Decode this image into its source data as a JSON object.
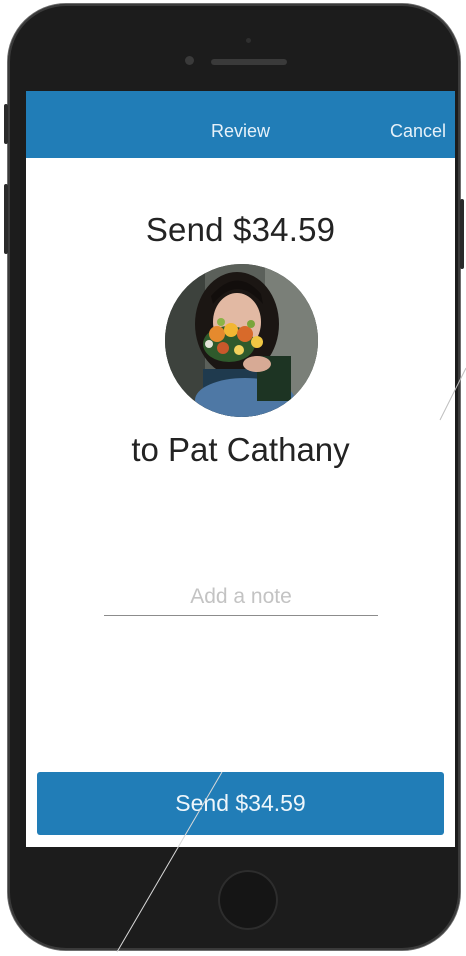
{
  "header": {
    "title": "Review",
    "cancel_label": "Cancel"
  },
  "payment": {
    "amount_heading": "Send $34.59",
    "recipient_line": "to Pat Cathany"
  },
  "note": {
    "placeholder": "Add a note",
    "value": ""
  },
  "actions": {
    "send_label": "Send $34.59"
  },
  "colors": {
    "accent": "#217db7",
    "phone_body": "#1c1c1c",
    "text": "#232323"
  }
}
